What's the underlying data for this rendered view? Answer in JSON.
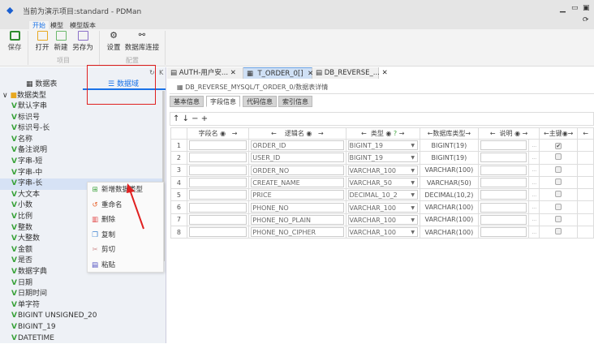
{
  "window": {
    "title": "当前为演示项目:standard - PDMan"
  },
  "ribbon": {
    "tabs": [
      "开始",
      "模型",
      "模型版本"
    ],
    "save": "保存",
    "open": "打开",
    "new": "新建",
    "save_as": "另存为",
    "group_project": "项目",
    "settings": "设置",
    "db_connect": "数据库连接",
    "group_config": "配置"
  },
  "sidebar": {
    "tab_tables": "数据表",
    "tab_domains": "数据域",
    "root": "数据类型",
    "items": [
      "默认字串",
      "标识号",
      "标识号-长",
      "名称",
      "备注说明",
      "字串-短",
      "字串-中",
      "字串-长",
      "大文本",
      "小数",
      "比例",
      "整数",
      "大整数",
      "金额",
      "是否",
      "数据字典",
      "日期",
      "日期时间",
      "单字符",
      "BIGINT UNSIGNED_20",
      "BIGINT_19",
      "DATETIME"
    ]
  },
  "context_menu": [
    "新增数据类型",
    "重命名",
    "删除",
    "复制",
    "剪切",
    "粘贴"
  ],
  "doc_tabs": [
    "AUTH-用户安...",
    "T_ORDER_0[]",
    "DB_REVERSE_..."
  ],
  "breadcrumb": "DB_REVERSE_MYSQL/T_ORDER_0/数据表详情",
  "sub_tabs": [
    "基本信息",
    "字段信息",
    "代码信息",
    "索引信息"
  ],
  "toolbar": [
    "↑",
    "↓",
    "−",
    "+"
  ],
  "columns": [
    "字段名",
    "逻辑名",
    "类型",
    "数据库类型",
    "说明",
    "主键"
  ],
  "rows": [
    {
      "n": "1",
      "logical": "ORDER_ID",
      "type": "BIGINT_19",
      "db": "BIGINT(19)",
      "pk": true
    },
    {
      "n": "2",
      "logical": "USER_ID",
      "type": "BIGINT_19",
      "db": "BIGINT(19)",
      "pk": false
    },
    {
      "n": "3",
      "logical": "ORDER_NO",
      "type": "VARCHAR_100",
      "db": "VARCHAR(100)",
      "pk": false
    },
    {
      "n": "4",
      "logical": "CREATE_NAME",
      "type": "VARCHAR_50",
      "db": "VARCHAR(50)",
      "pk": false
    },
    {
      "n": "5",
      "logical": "PRICE",
      "type": "DECIMAL_10_2",
      "db": "DECIMAL(10,2)",
      "pk": false
    },
    {
      "n": "6",
      "logical": "PHONE_NO",
      "type": "VARCHAR_100",
      "db": "VARCHAR(100)",
      "pk": false
    },
    {
      "n": "7",
      "logical": "PHONE_NO_PLAIN",
      "type": "VARCHAR_100",
      "db": "VARCHAR(100)",
      "pk": false
    },
    {
      "n": "8",
      "logical": "PHONE_NO_CIPHER",
      "type": "VARCHAR_100",
      "db": "VARCHAR(100)",
      "pk": false
    }
  ],
  "colors": {
    "accent": "#1a73e8",
    "highlight_box": "#e02020",
    "leaf_icon": "#3aa23a"
  }
}
